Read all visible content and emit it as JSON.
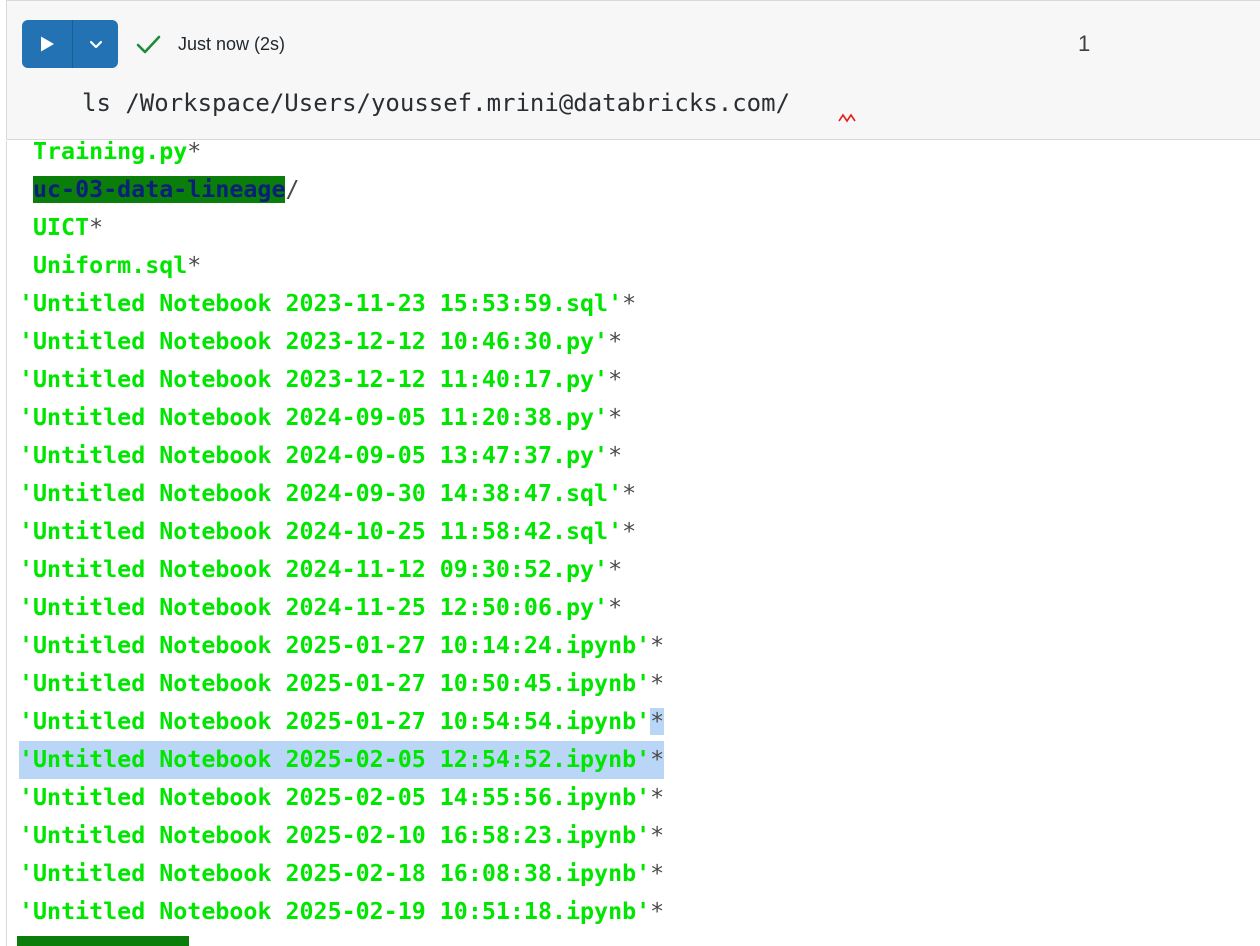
{
  "cell": {
    "status": "Just now (2s)",
    "cell_number": "1",
    "command": "ls /Workspace/Users/youssef.mrini@databricks.com/"
  },
  "output": {
    "lines": [
      {
        "name": "Training.py",
        "suffix": "*"
      },
      {
        "name": "uc-03-data-lineage",
        "suffix": "/"
      },
      {
        "name": "UICT",
        "suffix": "*"
      },
      {
        "name": "Uniform.sql",
        "suffix": "*"
      },
      {
        "name": "'Untitled Notebook 2023-11-23 15:53:59.sql'",
        "suffix": "*"
      },
      {
        "name": "'Untitled Notebook 2023-12-12 10:46:30.py'",
        "suffix": "*"
      },
      {
        "name": "'Untitled Notebook 2023-12-12 11:40:17.py'",
        "suffix": "*"
      },
      {
        "name": "'Untitled Notebook 2024-09-05 11:20:38.py'",
        "suffix": "*"
      },
      {
        "name": "'Untitled Notebook 2024-09-05 13:47:37.py'",
        "suffix": "*"
      },
      {
        "name": "'Untitled Notebook 2024-09-30 14:38:47.sql'",
        "suffix": "*"
      },
      {
        "name": "'Untitled Notebook 2024-10-25 11:58:42.sql'",
        "suffix": "*"
      },
      {
        "name": "'Untitled Notebook 2024-11-12 09:30:52.py'",
        "suffix": "*"
      },
      {
        "name": "'Untitled Notebook 2024-11-25 12:50:06.py'",
        "suffix": "*"
      },
      {
        "name": "'Untitled Notebook 2025-01-27 10:14:24.ipynb'",
        "suffix": "*"
      },
      {
        "name": "'Untitled Notebook 2025-01-27 10:50:45.ipynb'",
        "suffix": "*"
      },
      {
        "name": "'Untitled Notebook 2025-01-27 10:54:54.ipynb'",
        "suffix": "*"
      },
      {
        "name": "'Untitled Notebook 2025-02-05 12:54:52.ipynb'",
        "suffix": "*"
      },
      {
        "name": "'Untitled Notebook 2025-02-05 14:55:56.ipynb'",
        "suffix": "*"
      },
      {
        "name": "'Untitled Notebook 2025-02-10 16:58:23.ipynb'",
        "suffix": "*"
      },
      {
        "name": "'Untitled Notebook 2025-02-18 16:08:38.ipynb'",
        "suffix": "*"
      },
      {
        "name": "'Untitled Notebook 2025-02-19 10:51:18.ipynb'",
        "suffix": "*"
      }
    ]
  },
  "colors": {
    "run_button": "#2272b4",
    "check": "#1f8a3b",
    "output_text": "#00e600",
    "selection": "#b9d6f7"
  }
}
